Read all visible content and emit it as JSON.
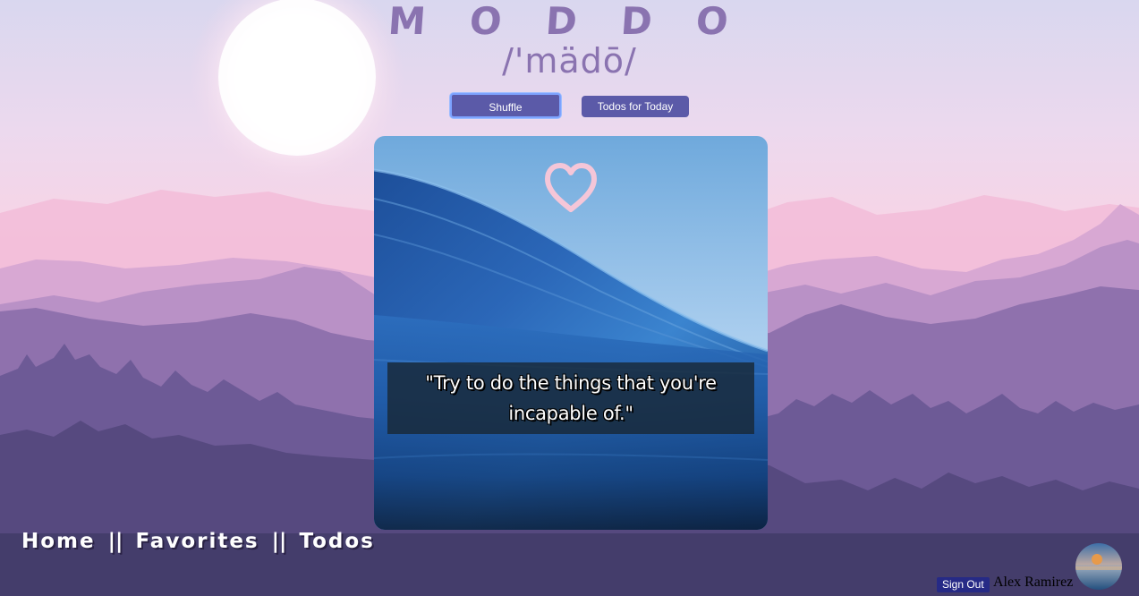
{
  "header": {
    "title_letters": [
      "M",
      "O",
      "D",
      "D",
      "O"
    ],
    "pronunciation": "/'mädō/"
  },
  "buttons": {
    "shuffle_label": "Shuffle",
    "todos_label": "Todos for Today"
  },
  "card": {
    "quote": "\"Try to do the things that you're incapable of.\"",
    "favorite_icon": "heart-outline-icon"
  },
  "nav": {
    "items": [
      {
        "label": "Home"
      },
      {
        "label": "Favorites"
      },
      {
        "label": "Todos"
      }
    ],
    "separator": "||"
  },
  "user": {
    "signout_label": "Sign Out",
    "name": "Alex Ramirez"
  },
  "colors": {
    "accent": "#5b5aa8",
    "title": "#8a73b0",
    "heart": "#f5c6d8",
    "signout": "#262a86"
  }
}
